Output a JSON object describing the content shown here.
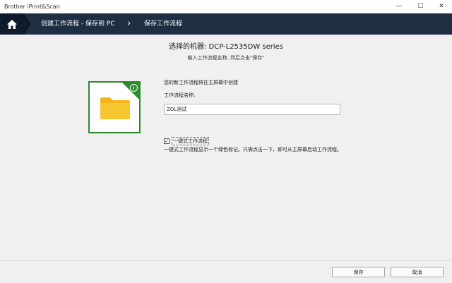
{
  "window": {
    "title": "Brother iPrint&Scan",
    "minimize_symbol": "—",
    "maximize_symbol": "☐",
    "close_symbol": "✕"
  },
  "nav": {
    "home_icon": "home-icon",
    "breadcrumb_1": "创建工作流程 - 保存到 PC",
    "separator": "›",
    "breadcrumb_2": "保存工作流程"
  },
  "header": {
    "machine": "选择的机器: DCP-L2535DW series",
    "instruction": "输入工作流程名称, 然后点击\"保存\""
  },
  "tile": {
    "icon": "folder-icon",
    "badge_icon": "one-touch-diamond-icon",
    "accent_color": "#2e8b2e",
    "folder_color": "#f7c325"
  },
  "form": {
    "created_note": "您的新工作流程将在主屏幕中创建",
    "name_label": "工作流程名称:",
    "name_value": "ZOL测试",
    "one_touch_checked": true,
    "one_touch_check_symbol": "✓",
    "one_touch_label": "一键式工作流程",
    "one_touch_desc": "一键式工作流程显示一个绿色标记。只需点击一下，即可从主屏幕启动工作流程。"
  },
  "footer": {
    "save_label": "保存",
    "cancel_label": "取消"
  }
}
